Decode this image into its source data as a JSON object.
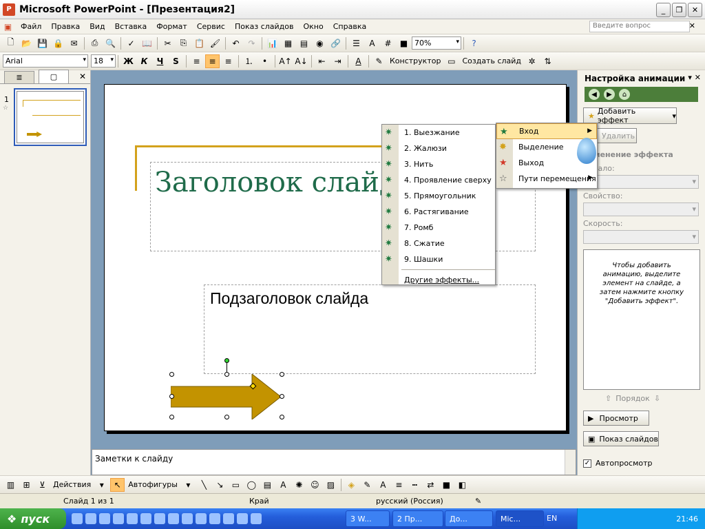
{
  "window": {
    "title": "Microsoft PowerPoint - [Презентация2]"
  },
  "menu": {
    "items": [
      "Файл",
      "Правка",
      "Вид",
      "Вставка",
      "Формат",
      "Сервис",
      "Показ слайдов",
      "Окно",
      "Справка"
    ],
    "ask_placeholder": "Введите вопрос"
  },
  "toolbar_standard": {
    "zoom": "70%"
  },
  "toolbar_format": {
    "font": "Arial",
    "size": "18",
    "bold": "Ж",
    "italic": "К",
    "underline": "Ч",
    "shadow": "S",
    "designer": "Конструктор",
    "new_slide": "Создать слайд"
  },
  "slides_pane": {
    "slide_number": "1"
  },
  "slide": {
    "title": "Заголовок слайда",
    "subtitle": "Подзаголовок слайда"
  },
  "notes": {
    "placeholder": "Заметки к слайду"
  },
  "effects_menu": {
    "items": [
      "1. Выезжание",
      "2. Жалюзи",
      "3. Нить",
      "4. Проявление сверху",
      "5. Прямоугольник",
      "6. Растягивание",
      "7. Ромб",
      "8. Сжатие",
      "9. Шашки"
    ],
    "more": "Другие эффекты..."
  },
  "type_menu": {
    "items": [
      "Вход",
      "Выделение",
      "Выход",
      "Пути перемещения"
    ]
  },
  "task_pane": {
    "title": "Настройка анимации",
    "add_effect": "Добавить эффект",
    "remove": "Удалить",
    "section": "Изменение эффекта",
    "start_label": "Начало:",
    "property_label": "Свойство:",
    "speed_label": "Скорость:",
    "hint": "Чтобы добавить анимацию, выделите элемент на слайде, а затем нажмите кнопку \"Добавить эффект\".",
    "order": "Порядок",
    "preview": "Просмотр",
    "slideshow": "Показ слайдов",
    "autopreview": "Автопросмотр"
  },
  "drawing_toolbar": {
    "actions": "Действия",
    "autoshapes": "Автофигуры"
  },
  "status": {
    "slide": "Слайд 1 из 1",
    "design": "Край",
    "language": "русский (Россия)"
  },
  "taskbar": {
    "start": "пуск",
    "tasks": [
      "3 W...",
      "2 Пр...",
      "До...",
      "Mic..."
    ],
    "lang": "EN",
    "clock": "21:46"
  },
  "colors": {
    "accent_gold": "#d3a21c",
    "title_green": "#1f6b4a",
    "arrow_fill": "#c39300",
    "highlight": "#ffe7a2"
  }
}
